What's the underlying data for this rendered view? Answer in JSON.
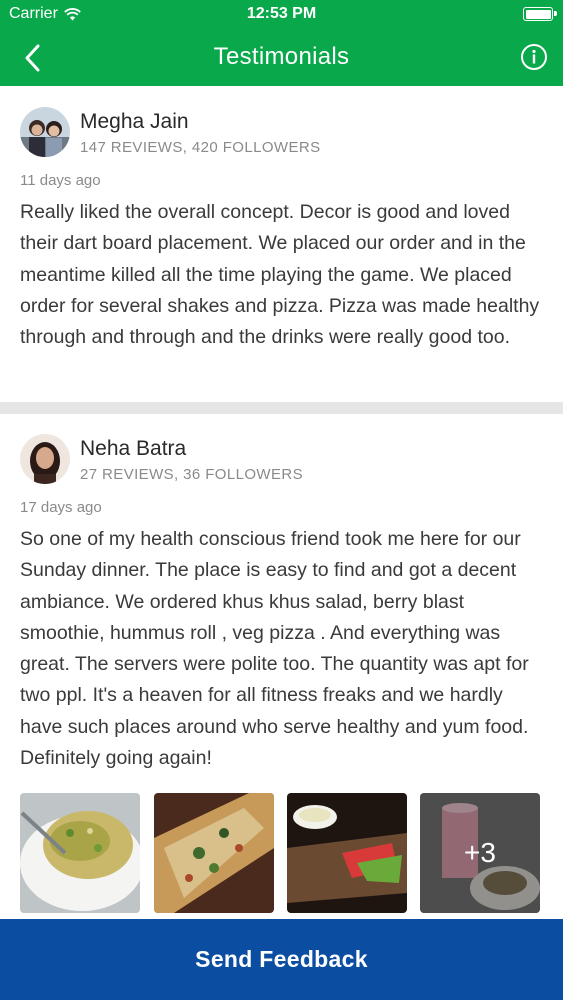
{
  "status_bar": {
    "carrier": "Carrier",
    "time": "12:53 PM",
    "wifi_icon": "wifi-icon",
    "battery_icon": "battery-icon"
  },
  "navbar": {
    "title": "Testimonials",
    "back_icon": "chevron-left-icon",
    "info_icon": "info-icon"
  },
  "reviews": [
    {
      "name": "Megha Jain",
      "meta": "147 REVIEWS, 420 FOLLOWERS",
      "date": "11 days ago",
      "text": "Really liked the overall concept. Decor is good and loved their dart board placement. We placed our order and in the meantime killed all the time playing the game. We placed order for several shakes and pizza. Pizza was made healthy through and through and the drinks were really good too."
    },
    {
      "name": "Neha Batra",
      "meta": "27 REVIEWS, 36 FOLLOWERS",
      "date": "17 days ago",
      "text": "So one of my health conscious friend took me here for our Sunday dinner. The place is easy to find and got a decent ambiance. We ordered khus khus salad, berry blast smoothie, hummus roll , veg pizza . And everything was great. The servers were polite too. The quantity was apt for two ppl. It's a heaven for all fitness freaks and we hardly have such places around who serve healthy and yum food. Definitely going again!",
      "photos_more": "+3"
    }
  ],
  "footer": {
    "button_label": "Send Feedback"
  },
  "colors": {
    "header": "#08a84b",
    "footer": "#0b4ea1",
    "divider": "#e6e6e6"
  }
}
